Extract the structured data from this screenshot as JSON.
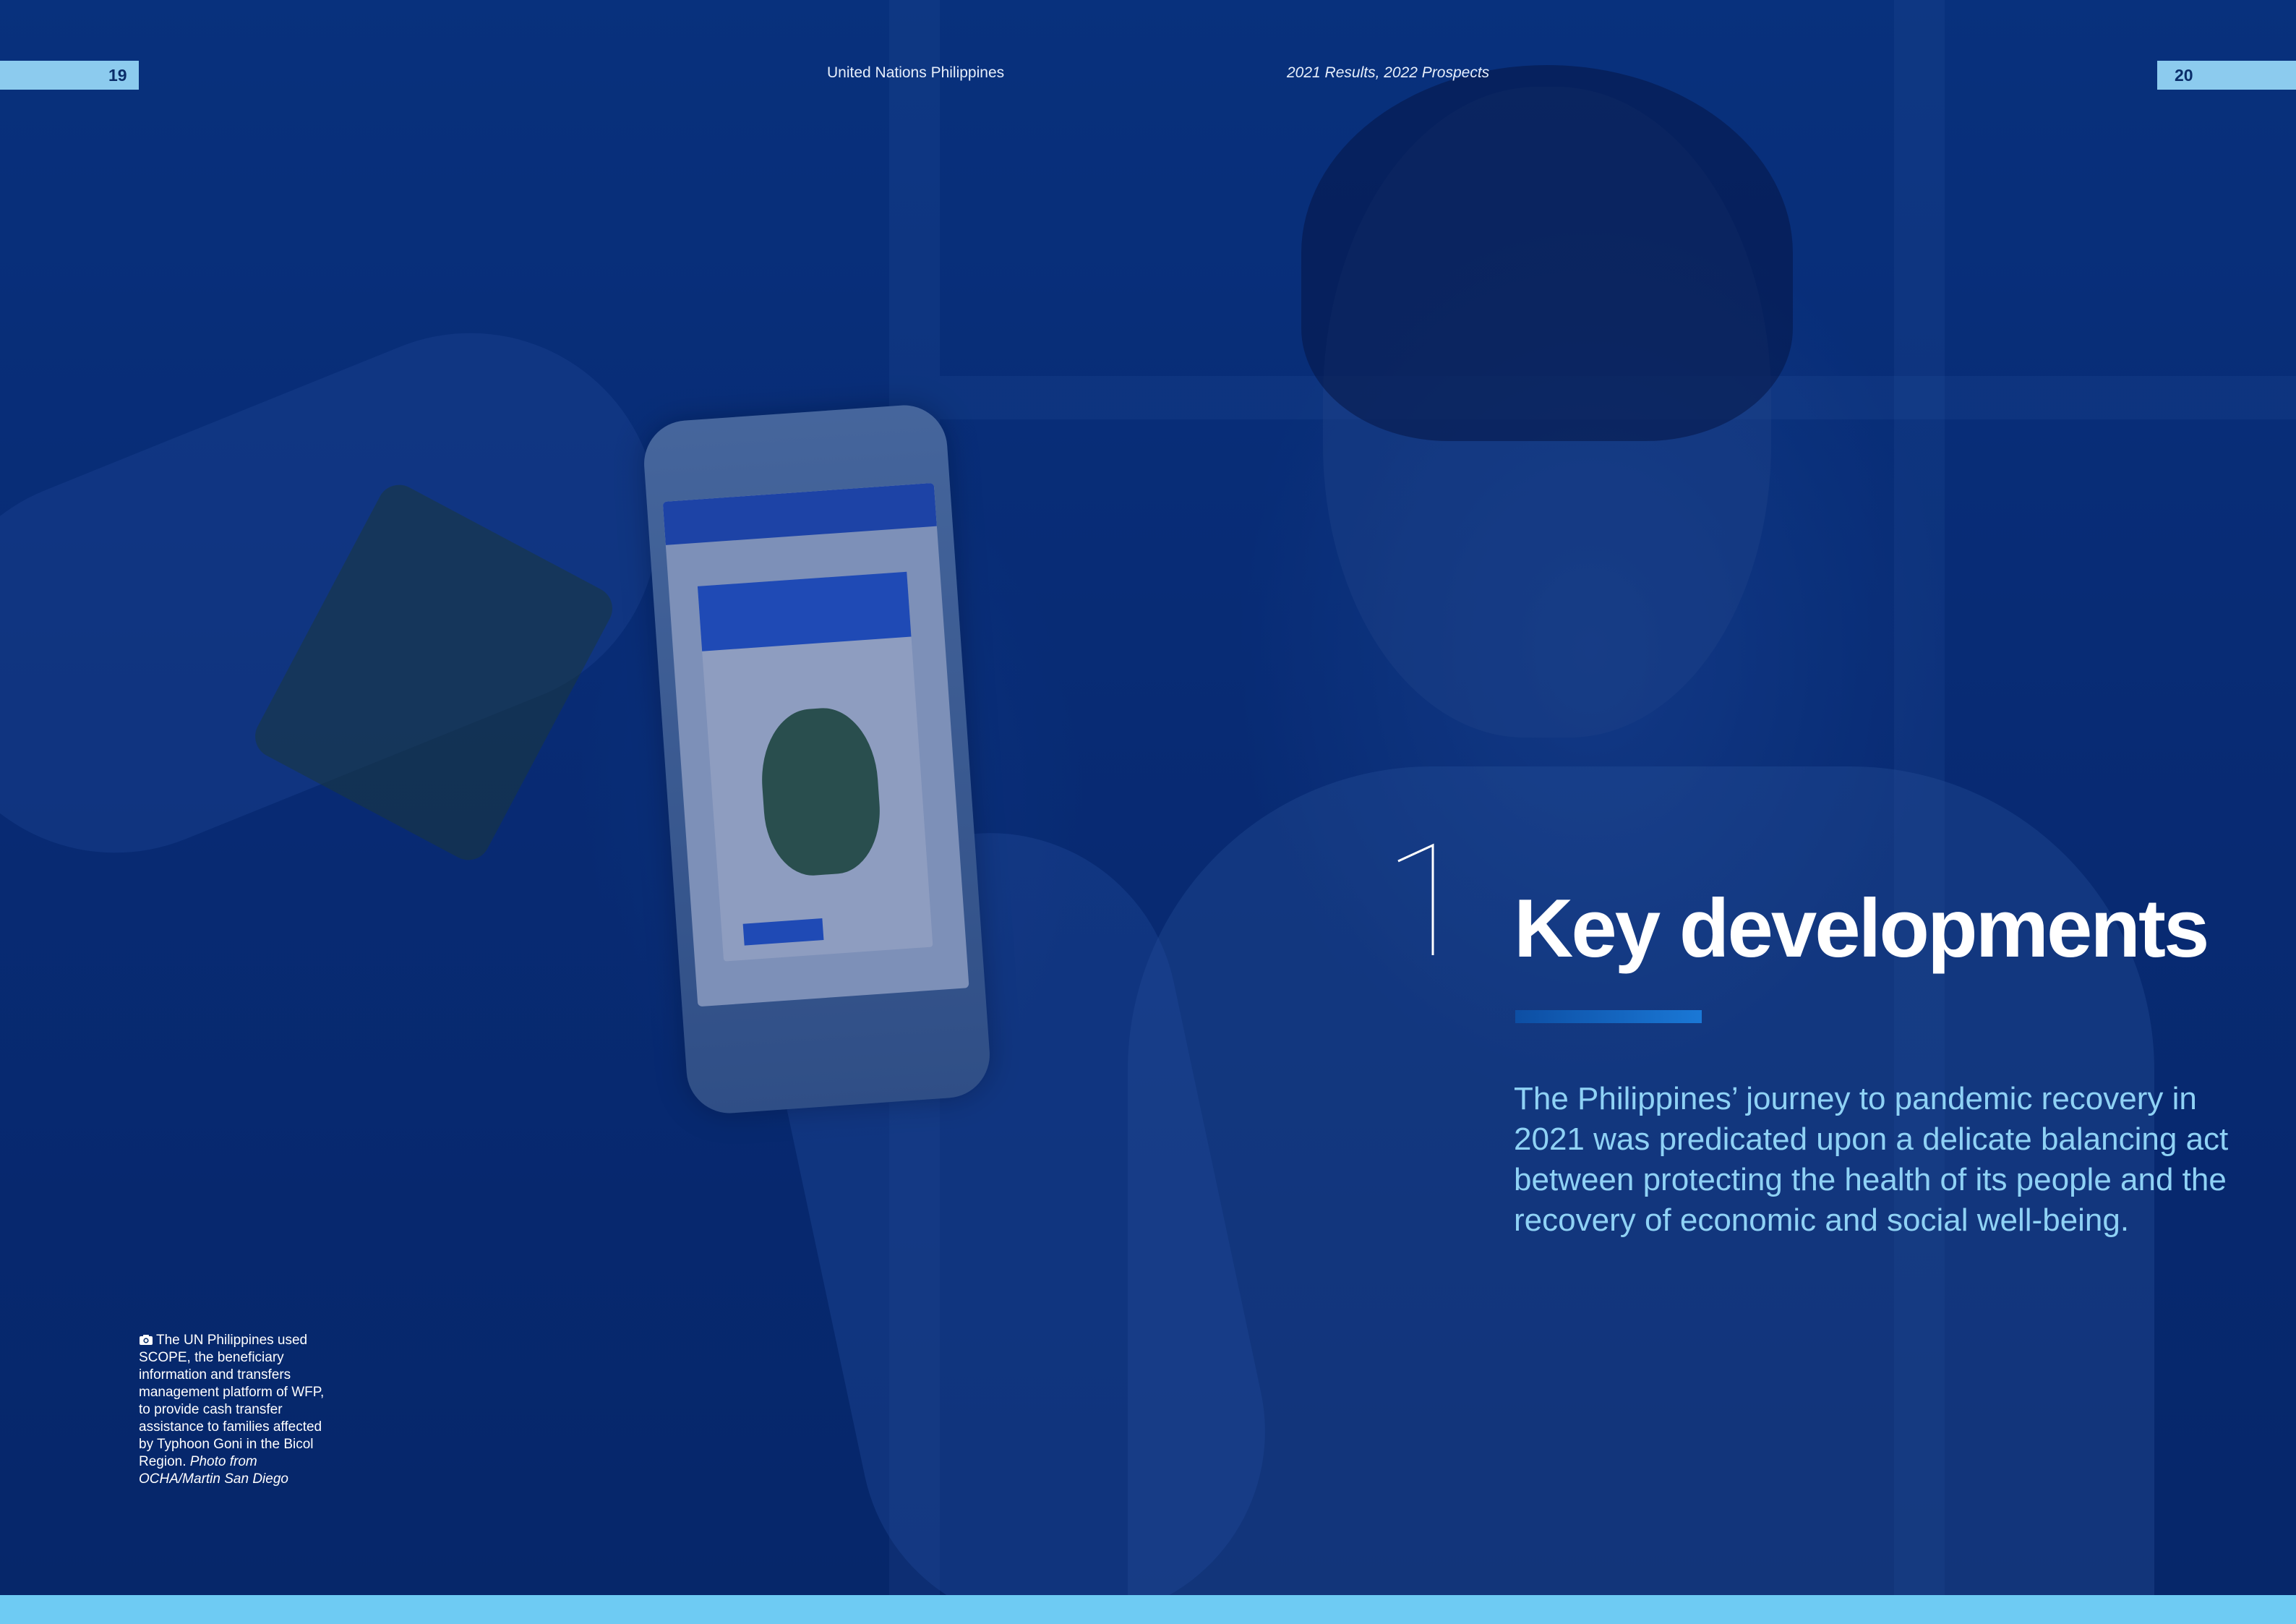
{
  "header": {
    "left_page_number": "19",
    "right_page_number": "20",
    "left_running_head": "United Nations Philippines",
    "right_running_head": "2021 Results, 2022 Prospects"
  },
  "chapter": {
    "number": "1",
    "title": "Key developments",
    "intro": "The Philippines’ journey to pandemic recovery in 2021 was predicated upon a delicate balancing act between protecting the health of its people and the recovery of economic and social well-being."
  },
  "photo_caption": {
    "text": "The UN Philippines used SCOPE, the beneficiary information and transfers management platform of WFP, to provide cash transfer assistance to families affected by Typhoon Goni in the Bicol Region.",
    "credit": "Photo from OCHA/Martin San Diego",
    "icon": "camera-icon"
  },
  "colors": {
    "tab": "#8ccbee",
    "bottom_band": "#6ecbf3",
    "intro_text": "#8fd2f5",
    "title_rule": "#1a78d6",
    "page_overlay": "#0a2e6a"
  }
}
